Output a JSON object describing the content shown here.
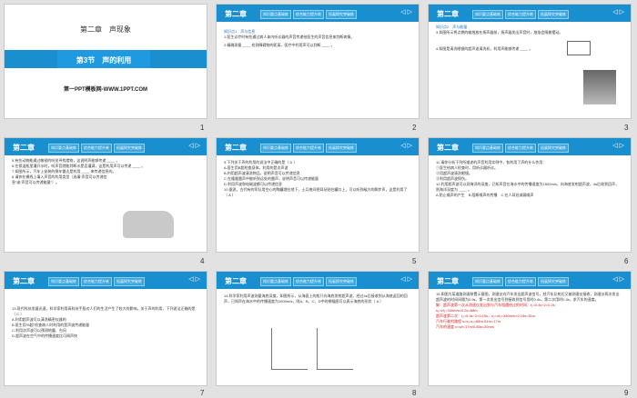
{
  "chapter": "第二章",
  "title_slide": {
    "chapter_title": "第二章　声现象",
    "section_title": "第3节　声的利用",
    "website": "第一PPT模板网-WWW.1PPT.COM"
  },
  "tabs": [
    "知识要点基础练",
    "综合能力提升练",
    "拓展探究突破练"
  ],
  "nav": "◁ ▷",
  "slides": [
    {
      "num": "1"
    },
    {
      "num": "2",
      "lines": [
        "知识点1　声与信息",
        "1.医生诊疗时有些通过病人体内听诊器的声音传递给医生的声音信息来判断病情。",
        "2.精确测量 ____ 检测障碍物的距离，医疗中利用声可以判断 ____ 。"
      ]
    },
    {
      "num": "3",
      "lines": [
        "知识点2　声与能量",
        "3.如图所示将点燃的蜡烛放在扬声器前，扬声器发出声音时，烛焰会随着摆动。",
        "4.如图是清洗眼镜的超声波清洗机，利用声能够传递 ____ 。"
      ]
    },
    {
      "num": "4",
      "lines": [
        "5.有些动物能通过敏锐的听觉寻找猎物，这说明声能够传递 ____ 。",
        "6.往保温瓶里灌开水时，听声音就能判断水是否灌满，这是利用声可以传递 ____ 。",
        "7.如图所示，汽车上安装的倒车雷达是利用 ____ 来传递信息的。",
        "8.请你在横线上填入声音的利用类型（选填“声音可以传递信息”或“声音可以传递能量”）。"
      ]
    },
    {
      "num": "5",
      "lines": [
        "9.下列关于声的利用的说法中正确的是（ D ）",
        "A.医生用B超检查身体，利用的是次声波",
        "B.利用超声波清洗物品，说明声音可以传递信息",
        "C.在隆隆雷声中能听到远处的雷声，说明声音可以传递能量",
        "D.利用声波和电磁波都可以传递信息",
        "10.据说，古代有的军队用空心的陶罐埋在地下，士兵夜间把耳朵贴在罐口上，可以听到敌方的脚步声，这是利用了（ A ）"
      ]
    },
    {
      "num": "6",
      "lines": [
        "11.请你分析下列所描述的声音利用实例中，各利用了声的什么作用：",
        "①医生给病人检查时，用听诊器听诊。",
        "②用超声波清洗眼镜。",
        "③利用超声波探伤。",
        "12.利用超声波可以测海洋的深度，已知声音在海水中的传播速度为1500m/s，向海底发射超声波，4s后收到回声，则海洋深度为 ____ 。",
        "A.防止噪声的产生　B.阻断噪声的传播　C.在人耳处减弱噪声"
      ]
    },
    {
      "num": "7",
      "lines": [
        "13.现代科技发展迅速，科学家利用高科技手段对人们的生活产生了较大的影响。关于声的利用，下列说法正确的是（ C ）",
        "A.利用超声波可以清洗精密仪器的",
        "B.医生用“B超”检查病人时利用的是声波传递能量",
        "C.利用次声波可以预测地震、台风",
        "D.超声波在空气中的传播速度比可闻声快"
      ]
    },
    {
      "num": "8",
      "lines": [
        "14.科学家利用声波测量海底深度，如图所示，从海面上的船只向海底发射超声波，经过4s后接收到从海底返回的回声，已知声在海水中的传播速度为1500m/s，则A、B、C、D中的哪幅图可以表示海底的形状（ A ）"
      ]
    },
    {
      "num": "9",
      "lines": [
        "15.如图为某道路测速装置示意图，测速仪向汽车发出超声波信号，经汽车反射后又被测速仪接收，测速仪两次发出超声波的时间间隔为0.9s，第一次发出信号到接收到信号用时0.4s，第二次用时0.3s，求汽车的速度。",
        "解：超声波第一次从测速仪发出到与汽车相遇经过的时间：t₁=0.4s÷2=0.2s",
        "s₁=vt₁=340m/s×0.2s=68m",
        "超声波第二次：t₂=0.3s÷2=0.15s，s₂=vt₂=340m/s×0.15s=51m",
        "汽车行驶的路程 s=s₁-s₂=68m-51m=17m",
        "汽车的速度 v=s/t=17m/0.85s=20m/s"
      ]
    }
  ]
}
